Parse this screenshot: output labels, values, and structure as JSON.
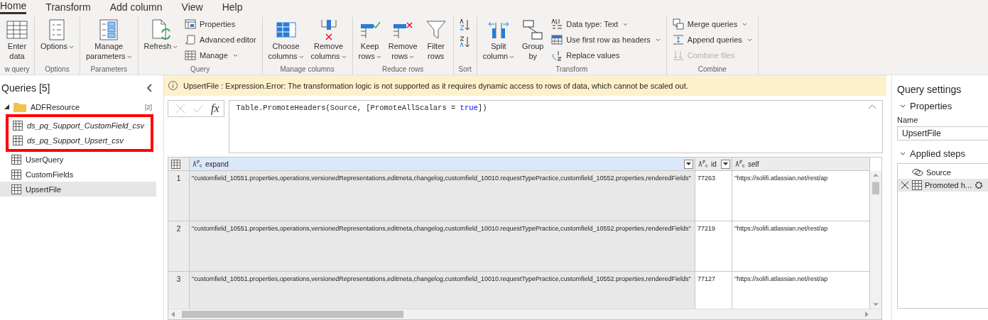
{
  "ribbon": {
    "tabs": [
      {
        "label": "Home",
        "selected": true
      },
      {
        "label": "Transform",
        "selected": false
      },
      {
        "label": "Add column",
        "selected": false
      },
      {
        "label": "View",
        "selected": false
      },
      {
        "label": "Help",
        "selected": false
      }
    ],
    "groups": [
      {
        "label": "w query",
        "items": [
          {
            "kind": "large",
            "label": "Enter\ndata",
            "dropdown": false,
            "disabled": false
          }
        ]
      },
      {
        "label": "Options",
        "items": [
          {
            "kind": "large",
            "label": "Options",
            "dropdown": true,
            "disabled": false
          }
        ]
      },
      {
        "label": "Parameters",
        "items": [
          {
            "kind": "large",
            "label": "Manage\nparameters",
            "dropdown": true,
            "disabled": false
          }
        ]
      },
      {
        "label": "Query",
        "items": [
          {
            "kind": "large",
            "label": "Refresh",
            "dropdown": true,
            "disabled": false
          },
          {
            "kind": "small",
            "label": "Properties",
            "dropdown": false,
            "disabled": false
          },
          {
            "kind": "small",
            "label": "Advanced editor",
            "dropdown": false,
            "disabled": false
          },
          {
            "kind": "small",
            "label": "Manage",
            "dropdown": true,
            "disabled": false
          }
        ]
      },
      {
        "label": "Manage columns",
        "items": [
          {
            "kind": "large",
            "label": "Choose\ncolumns",
            "dropdown": true,
            "disabled": false
          },
          {
            "kind": "large",
            "label": "Remove\ncolumns",
            "dropdown": true,
            "disabled": false
          }
        ]
      },
      {
        "label": "Reduce rows",
        "items": [
          {
            "kind": "large",
            "label": "Keep\nrows",
            "dropdown": true,
            "disabled": false
          },
          {
            "kind": "large",
            "label": "Remove\nrows",
            "dropdown": true,
            "disabled": false
          },
          {
            "kind": "large",
            "label": "Filter\nrows",
            "dropdown": false,
            "disabled": false
          }
        ]
      },
      {
        "label": "Sort",
        "items": [
          {
            "kind": "icon"
          },
          {
            "kind": "icon"
          }
        ]
      },
      {
        "label": "Transform",
        "items": [
          {
            "kind": "large",
            "label": "Split\ncolumn",
            "dropdown": true,
            "disabled": false
          },
          {
            "kind": "large",
            "label": "Group\nby",
            "dropdown": false,
            "disabled": false
          },
          {
            "kind": "small",
            "label": "Data type: Text",
            "dropdown": true,
            "disabled": false
          },
          {
            "kind": "small",
            "label": "Use first row as headers",
            "dropdown": true,
            "disabled": false
          },
          {
            "kind": "small",
            "label": "Replace values",
            "dropdown": false,
            "disabled": false
          }
        ]
      },
      {
        "label": "Combine",
        "items": [
          {
            "kind": "small",
            "label": "Merge queries",
            "dropdown": true,
            "disabled": false
          },
          {
            "kind": "small",
            "label": "Append queries",
            "dropdown": true,
            "disabled": false
          },
          {
            "kind": "small",
            "label": "Combine files",
            "dropdown": false,
            "disabled": true
          }
        ]
      }
    ]
  },
  "queries": {
    "title": "Queries [5]",
    "items": [
      {
        "label": "ADFResource",
        "kind": "folder",
        "count": "[2]",
        "expanded": true,
        "selected": false,
        "children": [
          {
            "label": "ds_pq_Support_CustomField_csv",
            "selected": false
          },
          {
            "label": "ds_pq_Support_Upsert_csv",
            "selected": false
          }
        ]
      },
      {
        "label": "UserQuery",
        "kind": "table",
        "selected": false
      },
      {
        "label": "CustomFields",
        "kind": "table",
        "selected": false
      },
      {
        "label": "UpsertFile",
        "kind": "table",
        "selected": true
      }
    ]
  },
  "warning": "UpsertFile : Expression.Error: The transformation logic is not supported as it requires dynamic access to rows of data, which cannot be scaled out.",
  "formula": {
    "fx": "fx",
    "parts": [
      {
        "text": "Table.PromoteHeaders(Source, [PromoteAllScalars = ",
        "kind": "plain"
      },
      {
        "text": "true",
        "kind": "keyword"
      },
      {
        "text": "])",
        "kind": "plain"
      }
    ]
  },
  "table": {
    "columns": [
      {
        "name": "expand",
        "filter": true,
        "selected": true
      },
      {
        "name": "id",
        "filter": true,
        "selected": false
      },
      {
        "name": "self",
        "filter": false,
        "selected": false
      }
    ],
    "rows": [
      {
        "number": "1",
        "cells": [
          "\"customfield_10551.properties,operations,versionedRepresentations,editmeta,changelog,customfield_10010.requestTypePractice,customfield_10552.properties,renderedFields\"",
          "77263",
          "\"https://solifi.atlassian.net/rest/ap"
        ]
      },
      {
        "number": "2",
        "cells": [
          "\"customfield_10551.properties,operations,versionedRepresentations,editmeta,changelog,customfield_10010.requestTypePractice,customfield_10552.properties,renderedFields\"",
          "77219",
          "\"https://solifi.atlassian.net/rest/ap"
        ]
      },
      {
        "number": "3",
        "cells": [
          "\"customfield_10551.properties,operations,versionedRepresentations,editmeta,changelog,customfield_10010.requestTypePractice,customfield_10552.properties,renderedFields\"",
          "77127",
          "\"https://solifi.atlassian.net/rest/ap"
        ]
      }
    ]
  },
  "settings": {
    "title": "Query settings",
    "properties": {
      "title": "Properties",
      "expanded": true,
      "name_label": "Name",
      "name_value": "UpsertFile"
    },
    "steps": {
      "title": "Applied steps",
      "expanded": true,
      "items": [
        {
          "label": "Source",
          "kind": "source",
          "selected": false
        },
        {
          "label": "Promoted h...",
          "kind": "table",
          "selected": true
        }
      ]
    }
  }
}
